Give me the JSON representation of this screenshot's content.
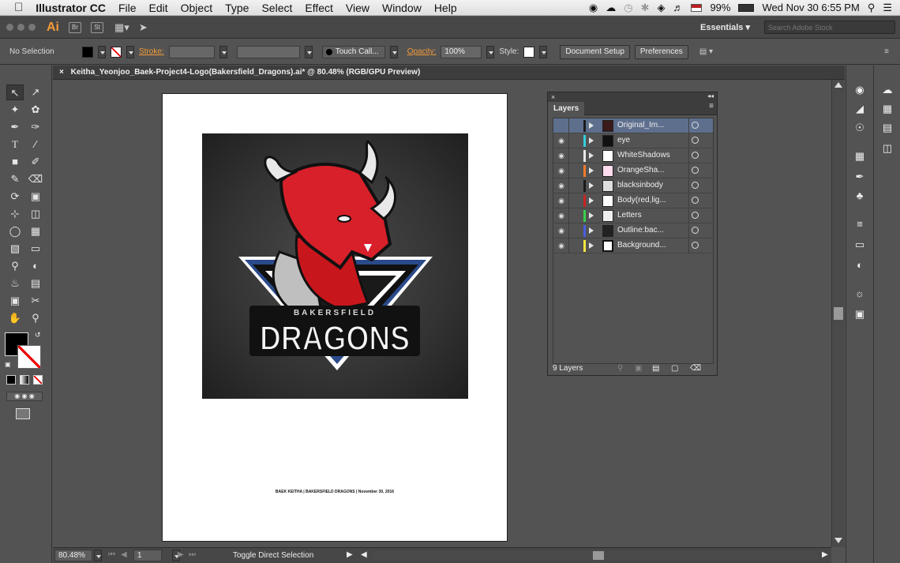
{
  "menubar": {
    "app_name": "Illustrator CC",
    "items": [
      "File",
      "Edit",
      "Object",
      "Type",
      "Select",
      "Effect",
      "View",
      "Window",
      "Help"
    ],
    "battery": "99%",
    "datetime": "Wed Nov 30  6:55 PM"
  },
  "appbar": {
    "logo": "Ai",
    "bridge": "Br",
    "stock": "St",
    "workspace": "Essentials",
    "search_placeholder": "Search Adobe Stock"
  },
  "control": {
    "selection": "No Selection",
    "stroke_label": "Stroke:",
    "brush_name": "Touch Call...",
    "opacity_label": "Opacity:",
    "opacity_value": "100%",
    "style_label": "Style:",
    "document_setup": "Document Setup",
    "preferences": "Preferences"
  },
  "document": {
    "tab_title": "Keitha_Yeonjoo_Baek-Project4-Logo(Bakersfield_Dragons).ai* @ 80.48% (RGB/GPU Preview)",
    "logo_top_text": "BAKERSFIELD",
    "logo_main_text": "DRAGONS",
    "footer_text": "BAEK KEITHA | BAKERSFIELD DRAGONS | November 30, 2016"
  },
  "layers_panel": {
    "tab": "Layers",
    "count": "9 Layers",
    "layers": [
      {
        "name": "Original_Im...",
        "color": "#1a1a1a",
        "selected": true
      },
      {
        "name": "eye",
        "color": "#33cfe0",
        "selected": false
      },
      {
        "name": "WhiteShadows",
        "color": "#e8e8e8",
        "selected": false
      },
      {
        "name": "OrangeSha...",
        "color": "#f07a2a",
        "selected": false
      },
      {
        "name": "blacksinbody",
        "color": "#1a1a1a",
        "selected": false
      },
      {
        "name": "Body(red,lig...",
        "color": "#cc2222",
        "selected": false
      },
      {
        "name": "Letters",
        "color": "#36d04a",
        "selected": false
      },
      {
        "name": "Outline:bac...",
        "color": "#4a5de0",
        "selected": false
      },
      {
        "name": "Background...",
        "color": "#f4e640",
        "selected": false
      }
    ]
  },
  "status": {
    "zoom": "80.48%",
    "page": "1",
    "tool_hint": "Toggle Direct Selection"
  }
}
